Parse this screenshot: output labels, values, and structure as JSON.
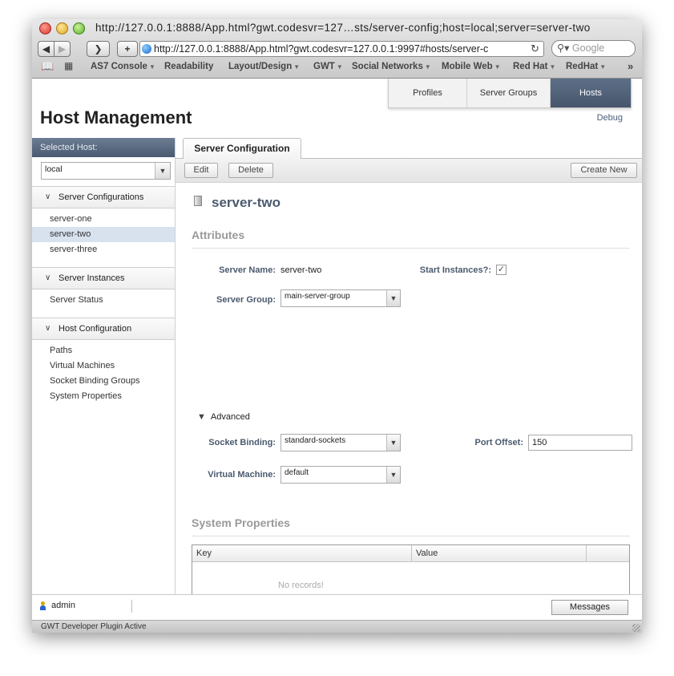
{
  "window": {
    "title": "http://127.0.0.1:8888/App.html?gwt.codesvr=127…sts/server-config;host=local;server=server-two"
  },
  "toolbar": {
    "back": "◀",
    "forward": "▶",
    "reader": "❯",
    "add": "+",
    "url": "http://127.0.0.1:8888/App.html?gwt.codesvr=127.0.0.1:9997#hosts/server-c",
    "reload": "↻",
    "search_placeholder": "Google"
  },
  "bookmarks": [
    {
      "label": "AS7 Console",
      "menu": true
    },
    {
      "label": "Readability",
      "menu": false
    },
    {
      "label": "Layout/Design",
      "menu": true
    },
    {
      "label": "GWT",
      "menu": true
    },
    {
      "label": "Social Networks",
      "menu": true
    },
    {
      "label": "Mobile Web",
      "menu": true
    },
    {
      "label": "Red Hat",
      "menu": true
    },
    {
      "label": "RedHat",
      "menu": true
    }
  ],
  "bookmarks_overflow": "»",
  "header": {
    "title": "Host Management",
    "debug": "Debug",
    "tabs": [
      {
        "label": "Profiles",
        "active": false
      },
      {
        "label": "Server Groups",
        "active": false
      },
      {
        "label": "Hosts",
        "active": true
      }
    ]
  },
  "sidebar": {
    "selected_host_label": "Selected Host:",
    "host_value": "local",
    "sections": [
      {
        "title": "Server Configurations",
        "items": [
          "server-one",
          "server-two",
          "server-three"
        ],
        "selected": "server-two"
      },
      {
        "title": "Server Instances",
        "items": [
          "Server Status"
        ]
      },
      {
        "title": "Host Configuration",
        "items": [
          "Paths",
          "Virtual Machines",
          "Socket Binding Groups",
          "System Properties"
        ]
      }
    ]
  },
  "main": {
    "tab_label": "Server Configuration",
    "buttons": {
      "edit": "Edit",
      "delete": "Delete",
      "create_new": "Create New"
    },
    "server_title": "server-two",
    "attributes_title": "Attributes",
    "fields": {
      "server_name_label": "Server Name:",
      "server_name_value": "server-two",
      "start_instances_label": "Start Instances?:",
      "start_instances_checked": true,
      "server_group_label": "Server Group:",
      "server_group_value": "main-server-group"
    },
    "advanced_label": "Advanced",
    "advanced": {
      "socket_binding_label": "Socket Binding:",
      "socket_binding_value": "standard-sockets",
      "port_offset_label": "Port Offset:",
      "port_offset_value": "150",
      "virtual_machine_label": "Virtual Machine:",
      "virtual_machine_value": "default"
    },
    "system_properties_title": "System Properties",
    "table": {
      "columns": [
        "Key",
        "Value",
        ""
      ],
      "empty_text": "No records!"
    }
  },
  "footer": {
    "user": "admin",
    "messages_button": "Messages"
  },
  "statusbar": {
    "text": "GWT Developer Plugin Active"
  },
  "colors": {
    "accent": "#4a5a70",
    "selected_row": "#d8e2ef",
    "label": "#4a5a6e"
  }
}
